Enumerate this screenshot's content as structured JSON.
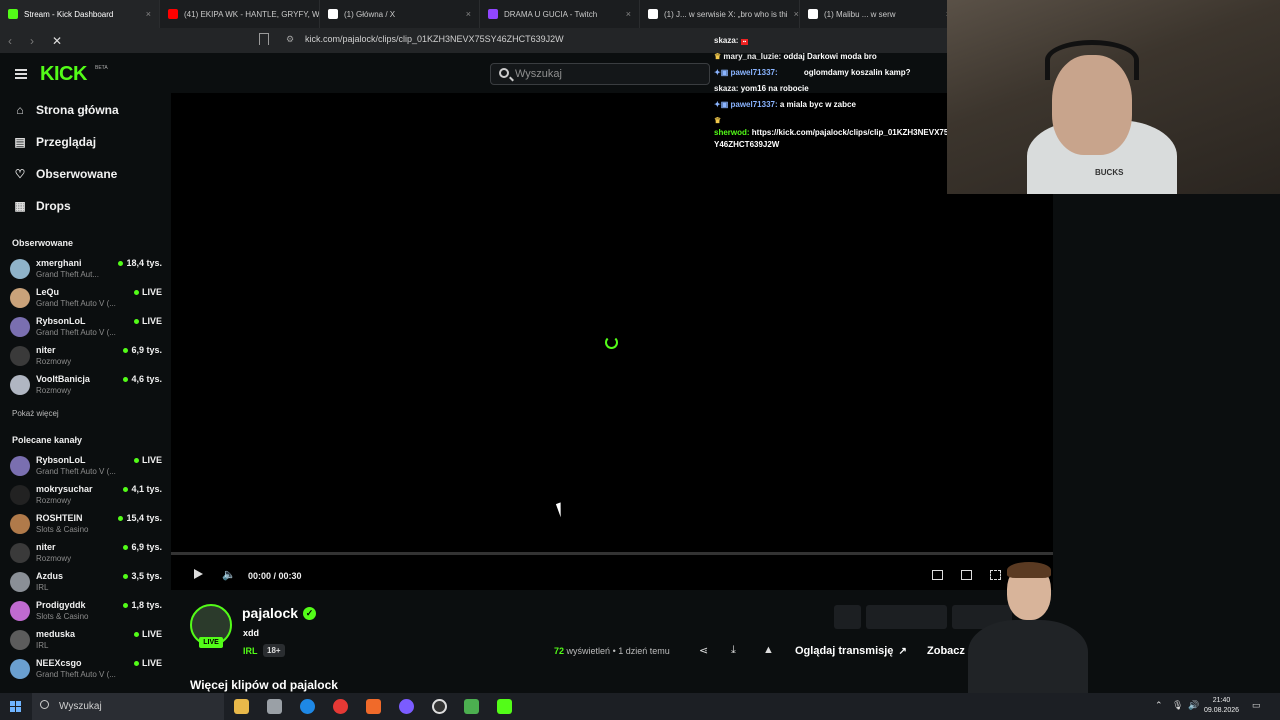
{
  "browser": {
    "tabs": [
      {
        "title": "Stream - Kick Dashboard",
        "color": "#53fc18"
      },
      {
        "title": "(41) EKIPA WK - HANTLE, GRYFY, W",
        "color": "#ff0000"
      },
      {
        "title": "(1) Główna / X",
        "color": "#ffffff"
      },
      {
        "title": "DRAMA U GUCIA - Twitch",
        "color": "#9146ff"
      },
      {
        "title": "(1) J... w serwisie X: „bro who is thi",
        "color": "#ffffff"
      },
      {
        "title": "(1) Malibu ... w serw",
        "color": "#ffffff"
      }
    ],
    "url": "kick.com/pajalock/clips/clip_01KZH3NEVX75SY46ZHCT639J2W"
  },
  "header": {
    "logo": "KICK",
    "beta": "BETA",
    "search_placeholder": "Wyszukaj"
  },
  "sidebar": {
    "nav": [
      {
        "label": "Strona główna",
        "icon": "home-icon"
      },
      {
        "label": "Przeglądaj",
        "icon": "browse-icon"
      },
      {
        "label": "Obserwowane",
        "icon": "heart-icon"
      },
      {
        "label": "Drops",
        "icon": "drops-icon"
      }
    ],
    "followed_title": "Obserwowane",
    "followed": [
      {
        "name": "xmerghani",
        "category": "Grand Theft Aut...",
        "viewers": "18,4 tys.",
        "color": "#8fb3c9"
      },
      {
        "name": "LeQu",
        "category": "Grand Theft Auto V (...",
        "viewers": "LIVE",
        "color": "#c9a27a"
      },
      {
        "name": "RybsonLoL",
        "category": "Grand Theft Auto V (...",
        "viewers": "LIVE",
        "color": "#7a6fb0"
      },
      {
        "name": "niter",
        "category": "Rozmowy",
        "viewers": "6,9 tys.",
        "color": "#3a3a3a"
      },
      {
        "name": "VooltBanicja",
        "category": "Rozmowy",
        "viewers": "4,6 tys.",
        "color": "#b0b6c2"
      }
    ],
    "show_more": "Pokaż więcej",
    "recommended_title": "Polecane kanały",
    "recommended": [
      {
        "name": "RybsonLoL",
        "category": "Grand Theft Auto V (...",
        "viewers": "LIVE",
        "color": "#7a6fb0"
      },
      {
        "name": "mokrysuchar",
        "category": "Rozmowy",
        "viewers": "4,1 tys.",
        "color": "#222222"
      },
      {
        "name": "ROSHTEIN",
        "category": "Slots & Casino",
        "viewers": "15,4 tys.",
        "color": "#b07a4a"
      },
      {
        "name": "niter",
        "category": "Rozmowy",
        "viewers": "6,9 tys.",
        "color": "#3a3a3a"
      },
      {
        "name": "Azdus",
        "category": "IRL",
        "viewers": "3,5 tys.",
        "color": "#8a8f96"
      },
      {
        "name": "Prodigyddk",
        "category": "Slots & Casino",
        "viewers": "1,8 tys.",
        "color": "#c06ad0"
      },
      {
        "name": "meduska",
        "category": "IRL",
        "viewers": "LIVE",
        "color": "#5c5c5c"
      },
      {
        "name": "NEEXcsgo",
        "category": "Grand Theft Auto V (...",
        "viewers": "LIVE",
        "color": "#6a9fd0"
      }
    ]
  },
  "player": {
    "time": "00:00 / 00:30",
    "progress": 0
  },
  "clip": {
    "streamer": "pajalock",
    "live": "LIVE",
    "title": "xdd",
    "category": "IRL",
    "age": "18+",
    "views_count": "72",
    "views_label": "wyświetleń",
    "ago": "• 1 dzień temu",
    "watch_label": "Oglądaj transmisję",
    "see_label": "Zobacz",
    "more_clips": "Więcej klipów od pajalock"
  },
  "chat": [
    {
      "user": "skaza:",
      "text": ""
    },
    {
      "user": "mary_na_luzie:",
      "text": "oddaj Darkowi moda bro"
    },
    {
      "user": "pawel71337:",
      "text": "oglomdamy koszalin kamp?"
    },
    {
      "user": "skaza:",
      "text": "yom16 na robocie"
    },
    {
      "user": "pawel71337:",
      "text": "a miala byc w zabce"
    },
    {
      "user": "sherwod:",
      "text": "https://kick.com/pajalock/clips/clip_01KZH3NEVX75S"
    },
    {
      "user": "",
      "text": "Y46ZHCT639J2W"
    }
  ],
  "webcam": {
    "shirt_text": "BUCKS"
  },
  "taskbar": {
    "search": "Wyszukaj",
    "time": "21:40",
    "date": "09.08.2026"
  }
}
